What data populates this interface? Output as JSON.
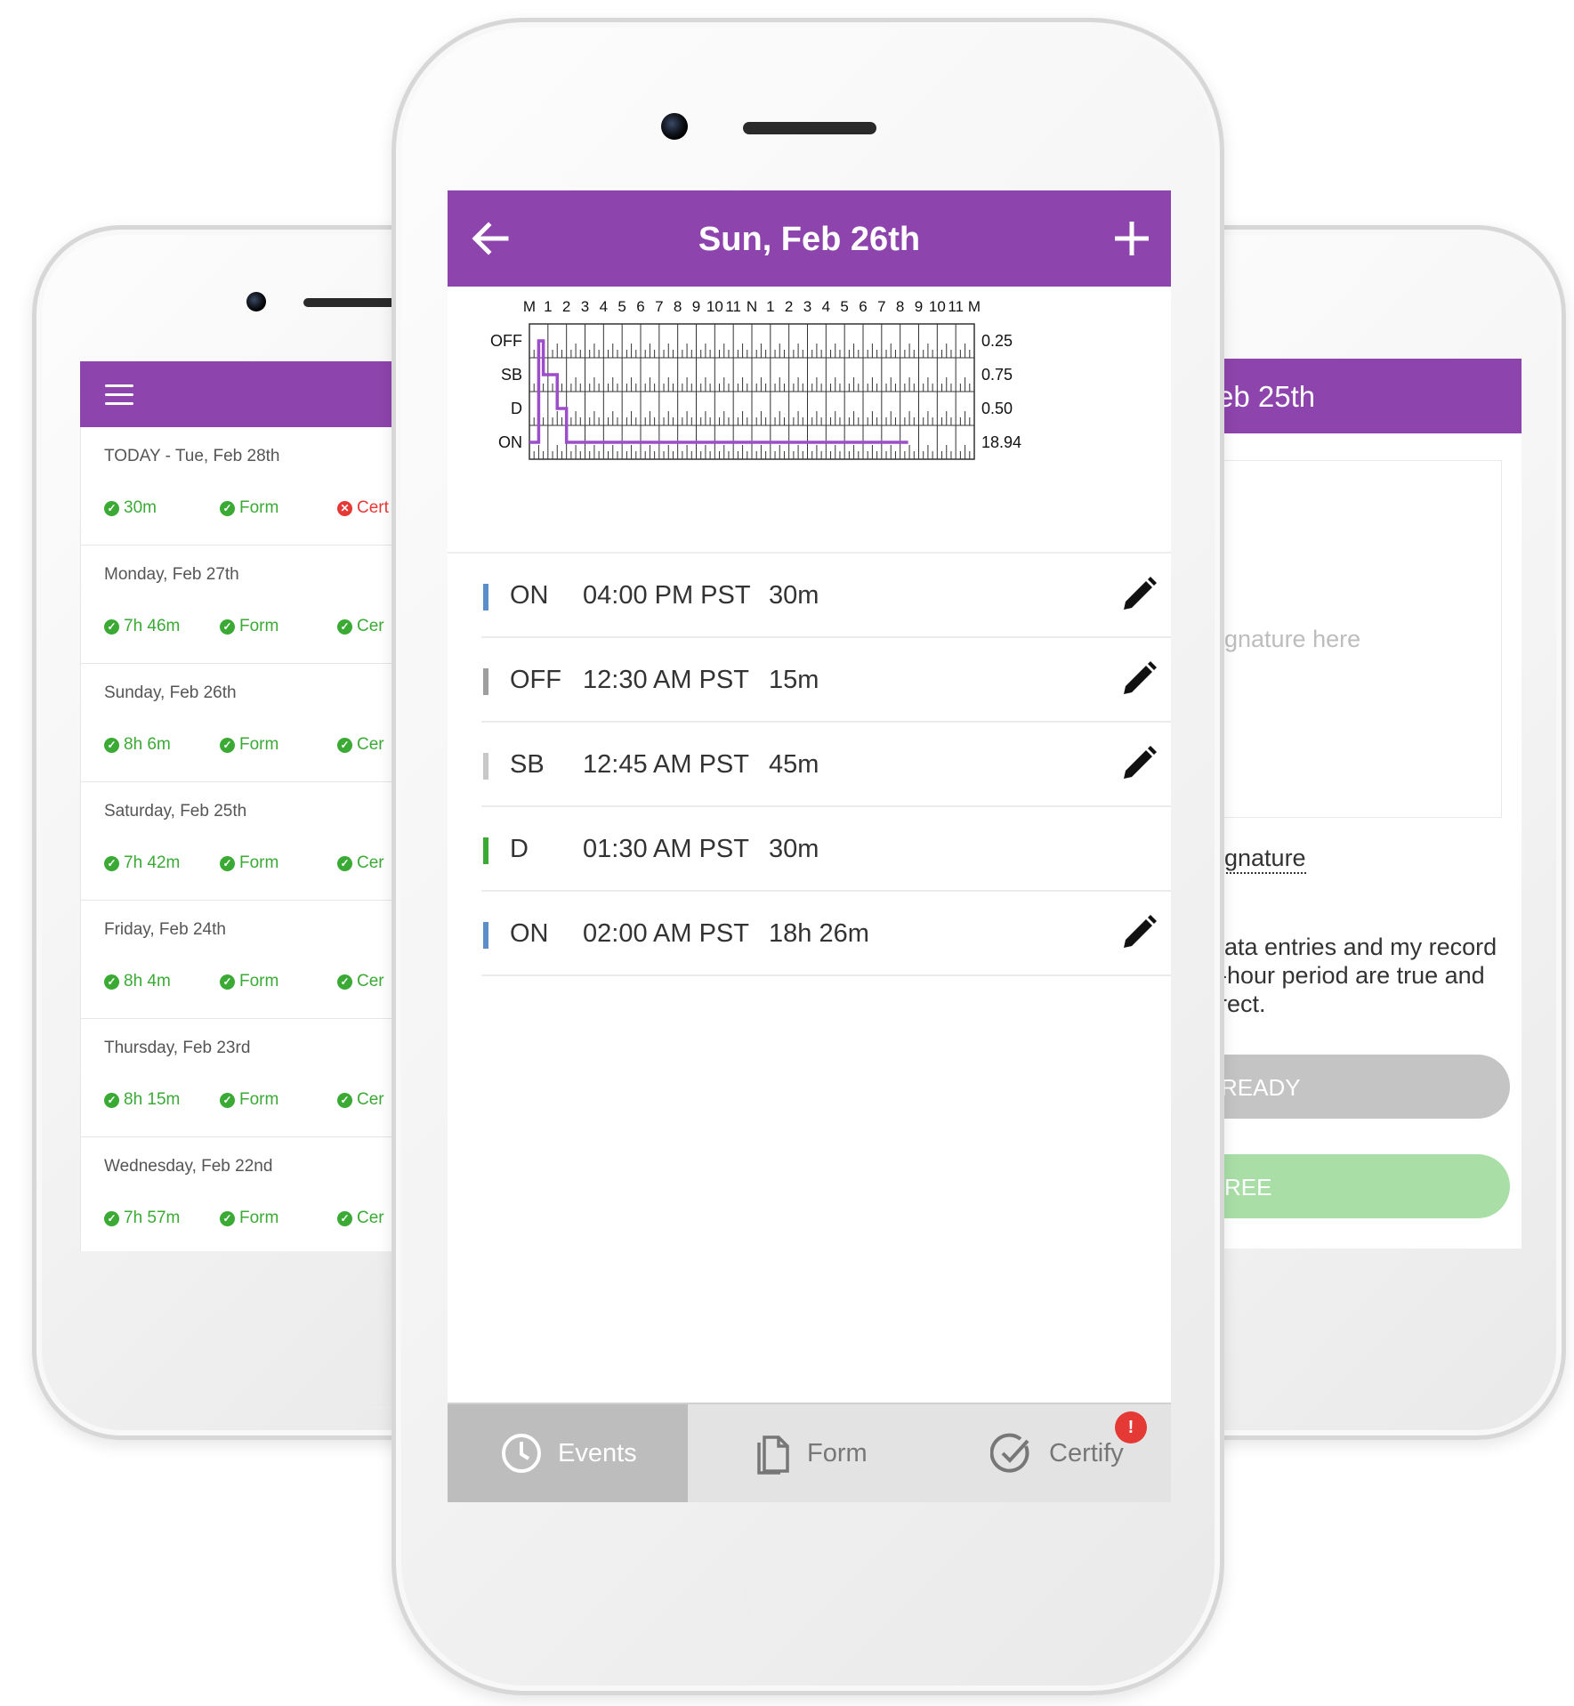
{
  "left_phone": {
    "days": [
      {
        "label": "TODAY - Tue, Feb 28th",
        "time": "30m",
        "form": "Form",
        "cert": "Cert",
        "cert_ok": false
      },
      {
        "label": "Monday, Feb 27th",
        "time": "7h 46m",
        "form": "Form",
        "cert": "Cer",
        "cert_ok": true
      },
      {
        "label": "Sunday, Feb 26th",
        "time": "8h 6m",
        "form": "Form",
        "cert": "Cer",
        "cert_ok": true
      },
      {
        "label": "Saturday, Feb 25th",
        "time": "7h 42m",
        "form": "Form",
        "cert": "Cer",
        "cert_ok": true
      },
      {
        "label": "Friday, Feb 24th",
        "time": "8h 4m",
        "form": "Form",
        "cert": "Cer",
        "cert_ok": true
      },
      {
        "label": "Thursday, Feb 23rd",
        "time": "8h 15m",
        "form": "Form",
        "cert": "Cer",
        "cert_ok": true
      },
      {
        "label": "Wednesday, Feb 22nd",
        "time": "7h 57m",
        "form": "Form",
        "cert": "Cer",
        "cert_ok": true
      }
    ]
  },
  "right_phone": {
    "header_title": "eb 25th",
    "signature_placeholder": "ignature here",
    "signature_link": "ignature",
    "cert_text_lines": [
      "lata entries and my record",
      "-hour period are true and",
      "rect."
    ],
    "ready_button": "READY",
    "agree_button": "REE"
  },
  "center_phone": {
    "header_title": "Sun, Feb 26th",
    "graph": {
      "hour_labels": [
        "M",
        "1",
        "2",
        "3",
        "4",
        "5",
        "6",
        "7",
        "8",
        "9",
        "10",
        "11",
        "N",
        "1",
        "2",
        "3",
        "4",
        "5",
        "6",
        "7",
        "8",
        "9",
        "10",
        "11",
        "M"
      ],
      "rows": [
        {
          "label": "OFF",
          "total": "0.25"
        },
        {
          "label": "SB",
          "total": "0.75"
        },
        {
          "label": "D",
          "total": "0.50"
        },
        {
          "label": "ON",
          "total": "18.94"
        }
      ],
      "line_color": "#9b4dca",
      "segments_hours": [
        {
          "row": 3,
          "start": 0.0,
          "end": 0.5
        },
        {
          "row": 0,
          "start": 0.5,
          "end": 0.75
        },
        {
          "row": 1,
          "start": 0.75,
          "end": 1.5
        },
        {
          "row": 2,
          "start": 1.5,
          "end": 2.0
        },
        {
          "row": 3,
          "start": 2.0,
          "end": 20.43
        }
      ]
    },
    "events": [
      {
        "status": "ON",
        "time": "04:00 PM PST",
        "duration": "30m",
        "color": "#5b8ec9",
        "editable": true
      },
      {
        "status": "OFF",
        "time": "12:30 AM PST",
        "duration": "15m",
        "color": "#9e9e9e",
        "editable": true
      },
      {
        "status": "SB",
        "time": "12:45 AM PST",
        "duration": "45m",
        "color": "#c8c8c8",
        "editable": true
      },
      {
        "status": "D",
        "time": "01:30 AM PST",
        "duration": "30m",
        "color": "#3aaa35",
        "editable": false
      },
      {
        "status": "ON",
        "time": "02:00 AM PST",
        "duration": "18h 26m",
        "color": "#5b8ec9",
        "editable": true
      }
    ],
    "tabs": {
      "events": "Events",
      "form": "Form",
      "certify": "Certify",
      "certify_badge": "!"
    }
  },
  "colors": {
    "header": "#8e44ad",
    "ok_green": "#3aaa35",
    "error_red": "#e53935"
  },
  "icons": {
    "menu": "hamburger-icon",
    "back": "arrow-left-icon",
    "add": "plus-icon",
    "edit": "pencil-icon",
    "events_tab": "clock-icon",
    "form_tab": "document-icon",
    "certify_tab": "check-circle-icon"
  }
}
